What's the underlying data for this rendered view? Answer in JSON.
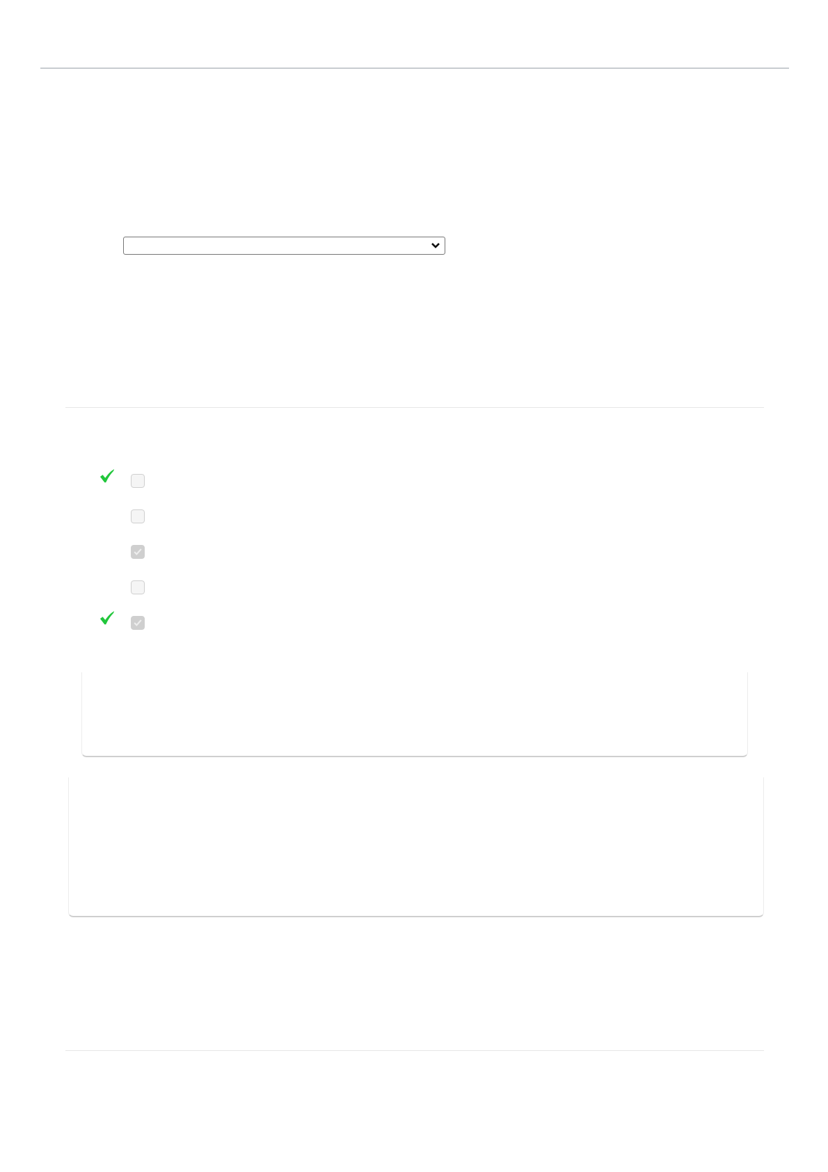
{
  "answer_select": {
    "expanded": false
  },
  "options": [
    {
      "checked": false,
      "marked_correct": true
    },
    {
      "checked": false,
      "marked_correct": false
    },
    {
      "checked": true,
      "marked_correct": false
    },
    {
      "checked": false,
      "marked_correct": false
    },
    {
      "checked": true,
      "marked_correct": true
    }
  ]
}
